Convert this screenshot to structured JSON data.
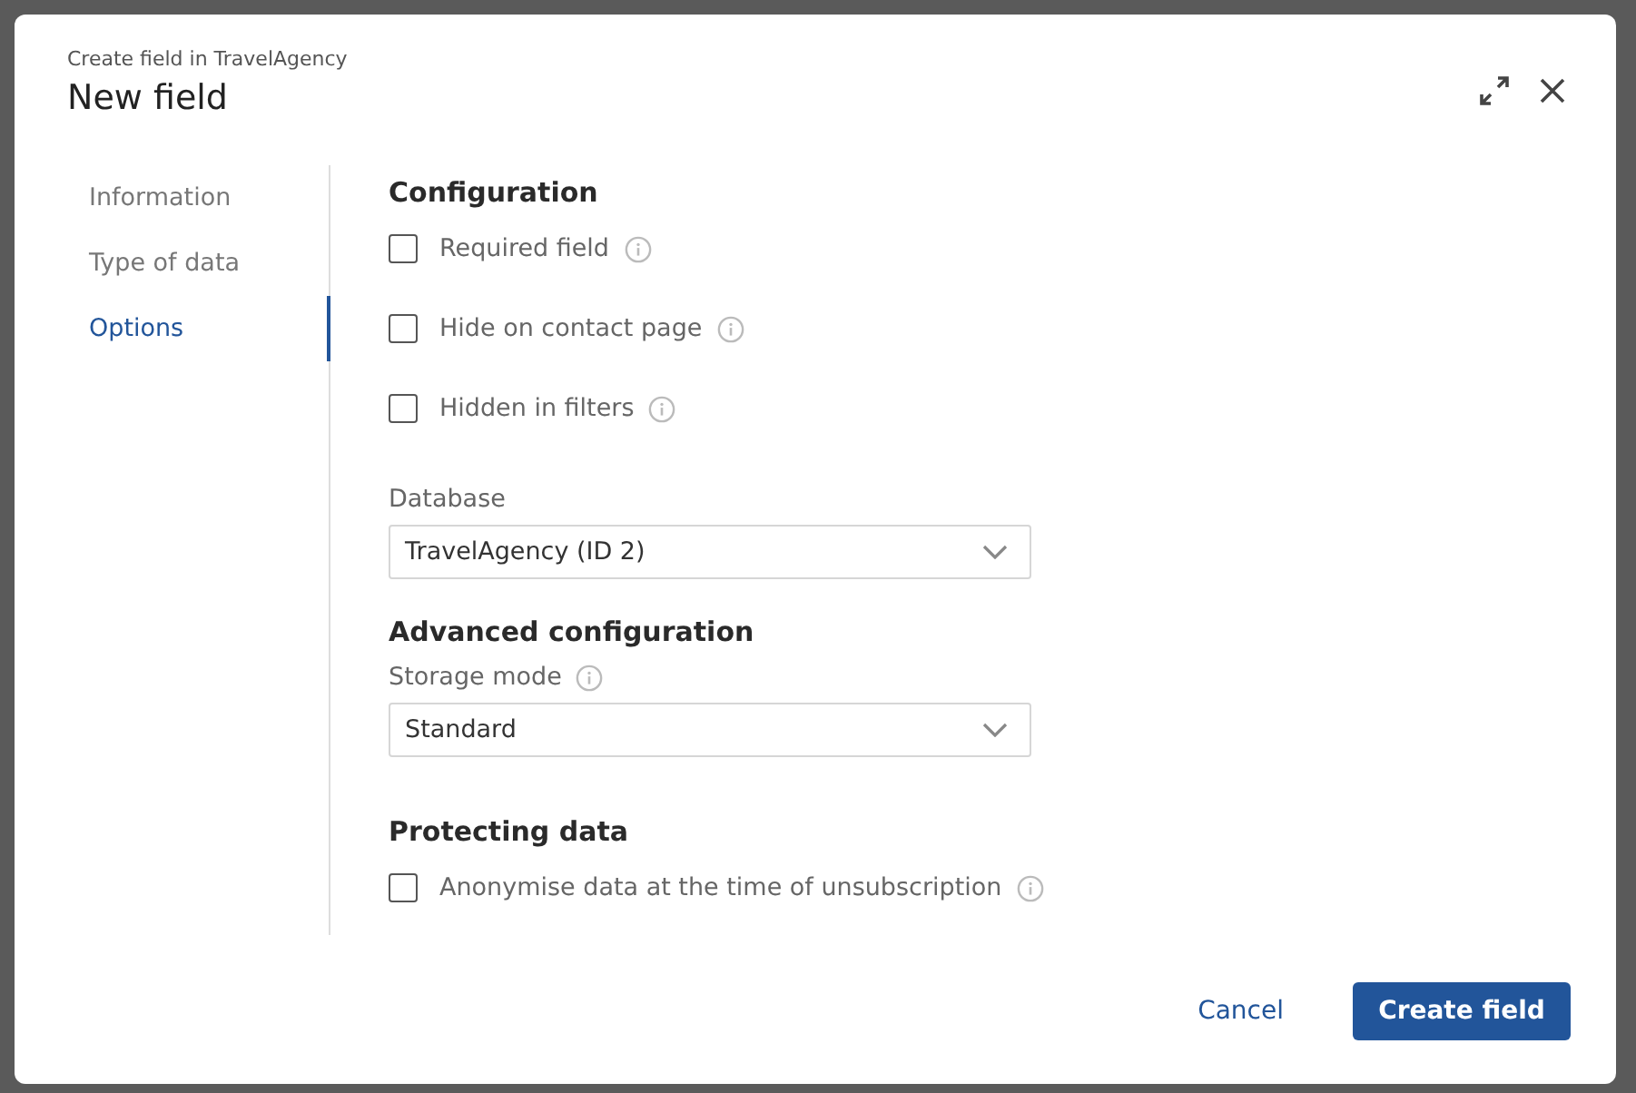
{
  "dialog": {
    "subtitle": "Create field in TravelAgency",
    "title": "New field"
  },
  "sidebar": {
    "items": [
      {
        "label": "Information",
        "selected": false
      },
      {
        "label": "Type of data",
        "selected": false
      },
      {
        "label": "Options",
        "selected": true
      }
    ]
  },
  "sections": [
    {
      "heading": "Configuration",
      "items": [
        {
          "kind": "checkbox",
          "label": "Required field",
          "checked": false,
          "info": true
        },
        {
          "kind": "checkbox",
          "label": "Hide on contact page",
          "checked": false,
          "info": true
        },
        {
          "kind": "checkbox",
          "label": "Hidden in filters",
          "checked": false,
          "info": true
        },
        {
          "kind": "select",
          "label": "Database",
          "value": "TravelAgency (ID 2)",
          "info": false
        }
      ]
    },
    {
      "heading": "Advanced configuration",
      "items": [
        {
          "kind": "select",
          "label": "Storage mode",
          "value": "Standard",
          "info": true
        }
      ]
    },
    {
      "heading": "Protecting data",
      "items": [
        {
          "kind": "checkbox",
          "label": "Anonymise data at the time of unsubscription",
          "checked": false,
          "info": true
        }
      ]
    }
  ],
  "buttons": {
    "cancel": "Cancel",
    "primary": "Create field"
  }
}
